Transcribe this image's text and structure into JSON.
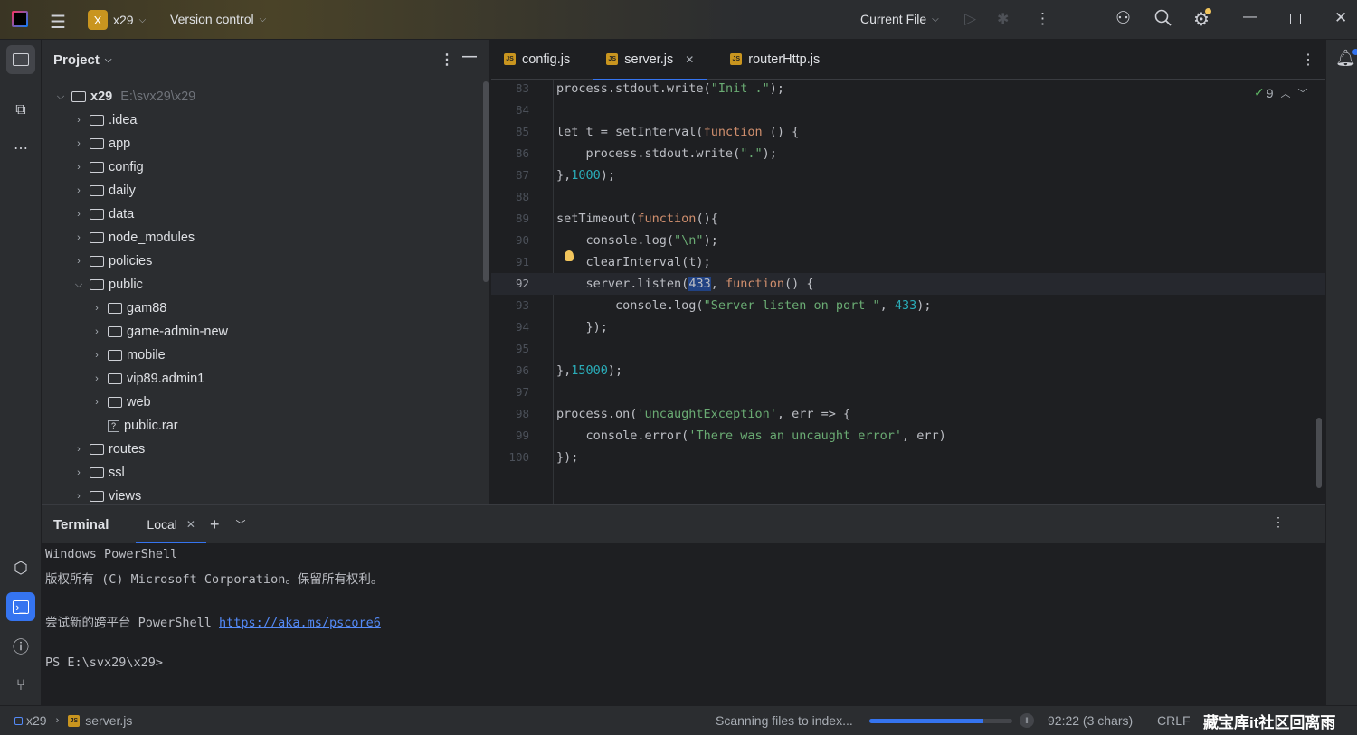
{
  "titlebar": {
    "project_initial": "X",
    "project_name": "x29",
    "vcs": "Version control",
    "run_config": "Current File"
  },
  "project_panel": {
    "title": "Project",
    "tree": [
      {
        "label": "x29",
        "path": "E:\\svx29\\x29",
        "depth": 0,
        "expanded": true,
        "type": "root"
      },
      {
        "label": ".idea",
        "depth": 1,
        "type": "folder"
      },
      {
        "label": "app",
        "depth": 1,
        "type": "folder"
      },
      {
        "label": "config",
        "depth": 1,
        "type": "folder"
      },
      {
        "label": "daily",
        "depth": 1,
        "type": "folder"
      },
      {
        "label": "data",
        "depth": 1,
        "type": "folder"
      },
      {
        "label": "node_modules",
        "depth": 1,
        "type": "folder"
      },
      {
        "label": "policies",
        "depth": 1,
        "type": "folder"
      },
      {
        "label": "public",
        "depth": 1,
        "type": "folder",
        "expanded": true
      },
      {
        "label": "gam88",
        "depth": 2,
        "type": "folder"
      },
      {
        "label": "game-admin-new",
        "depth": 2,
        "type": "folder"
      },
      {
        "label": "mobile",
        "depth": 2,
        "type": "folder"
      },
      {
        "label": "vip89.admin1",
        "depth": 2,
        "type": "folder"
      },
      {
        "label": "web",
        "depth": 2,
        "type": "folder"
      },
      {
        "label": "public.rar",
        "depth": 2,
        "type": "file"
      },
      {
        "label": "routes",
        "depth": 1,
        "type": "folder"
      },
      {
        "label": "ssl",
        "depth": 1,
        "type": "folder"
      },
      {
        "label": "views",
        "depth": 1,
        "type": "folder"
      }
    ]
  },
  "editor": {
    "tabs": [
      {
        "label": "config.js"
      },
      {
        "label": "server.js",
        "active": true
      },
      {
        "label": "routerHttp.js"
      }
    ],
    "problems_count": "9",
    "current_line": "92",
    "lines": [
      {
        "n": "83",
        "t": [
          [
            "",
            "process.stdout.write("
          ],
          [
            "str",
            "\"Init .\""
          ],
          [
            "",
            ");"
          ]
        ]
      },
      {
        "n": "84",
        "t": []
      },
      {
        "n": "85",
        "t": [
          [
            "",
            "let t = setInterval("
          ],
          [
            "kw",
            "function"
          ],
          [
            "",
            " () {"
          ]
        ]
      },
      {
        "n": "86",
        "t": [
          [
            "",
            "    process.stdout.write("
          ],
          [
            "str",
            "\".\""
          ],
          [
            "",
            ");"
          ]
        ]
      },
      {
        "n": "87",
        "t": [
          [
            "",
            "},"
          ],
          [
            "num",
            "1000"
          ],
          [
            "",
            ");"
          ]
        ]
      },
      {
        "n": "88",
        "t": []
      },
      {
        "n": "89",
        "t": [
          [
            "",
            "setTimeout("
          ],
          [
            "kw",
            "function"
          ],
          [
            "",
            "(){"
          ]
        ]
      },
      {
        "n": "90",
        "t": [
          [
            "",
            "    console.log("
          ],
          [
            "str",
            "\"\\n\""
          ],
          [
            "",
            ");"
          ]
        ]
      },
      {
        "n": "91",
        "t": [
          [
            "",
            "    clearInterval(t);"
          ]
        ]
      },
      {
        "n": "92",
        "t": [
          [
            "",
            "    server.listen("
          ],
          [
            "sel",
            "433"
          ],
          [
            "",
            ", "
          ],
          [
            "kw",
            "function"
          ],
          [
            "",
            "() {"
          ]
        ]
      },
      {
        "n": "93",
        "t": [
          [
            "",
            "        console.log("
          ],
          [
            "str",
            "\"Server listen on port \""
          ],
          [
            "",
            ", "
          ],
          [
            "num",
            "433"
          ],
          [
            "",
            ");"
          ]
        ]
      },
      {
        "n": "94",
        "t": [
          [
            "",
            "    });"
          ]
        ]
      },
      {
        "n": "95",
        "t": []
      },
      {
        "n": "96",
        "t": [
          [
            "",
            "},"
          ],
          [
            "num",
            "15000"
          ],
          [
            "",
            ");"
          ]
        ]
      },
      {
        "n": "97",
        "t": []
      },
      {
        "n": "98",
        "t": [
          [
            "",
            "process.on("
          ],
          [
            "str",
            "'uncaughtException'"
          ],
          [
            "",
            ", err => {"
          ]
        ]
      },
      {
        "n": "99",
        "t": [
          [
            "",
            "    console.error("
          ],
          [
            "str",
            "'There was an uncaught error'"
          ],
          [
            "",
            ", err)"
          ]
        ]
      },
      {
        "n": "100",
        "t": [
          [
            "",
            "});"
          ]
        ]
      }
    ]
  },
  "terminal": {
    "title": "Terminal",
    "tab": "Local",
    "line1": "Windows PowerShell",
    "line2": "版权所有 (C) Microsoft Corporation。保留所有权利。",
    "line3_prefix": "尝试新的跨平台 PowerShell ",
    "line3_link": "https://aka.ms/pscore6",
    "prompt": "PS E:\\svx29\\x29>"
  },
  "statusbar": {
    "project": "x29",
    "file": "server.js",
    "indexing": "Scanning files to index...",
    "progress_percent": 80,
    "position": "92:22 (3 chars)",
    "line_ending": "CRLF",
    "watermark": "藏宝库it社区回离雨"
  },
  "colors": {
    "accent": "#3574f0",
    "keyword": "#cf8e6d",
    "string": "#6aab73",
    "number": "#2aacb8"
  }
}
